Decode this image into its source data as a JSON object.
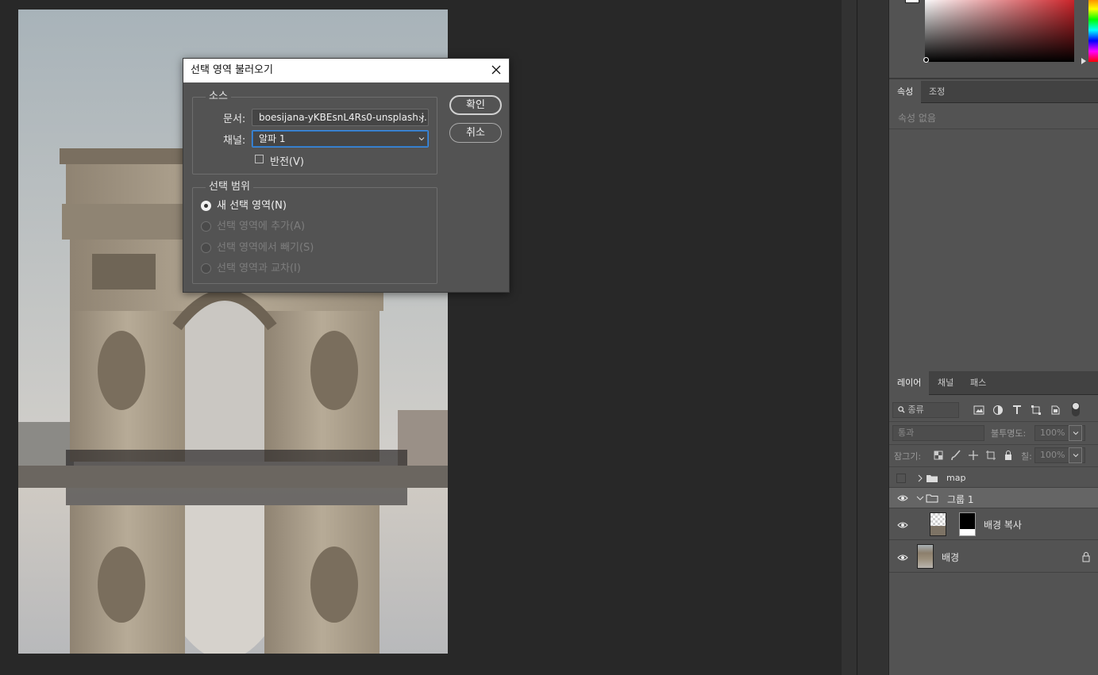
{
  "dialog": {
    "title": "선택 영역 불러오기",
    "source_group": "소스",
    "document_label": "문서:",
    "document_value": "boesijana-yKBEsnL4Rs0-unsplash.j...",
    "channel_label": "채널:",
    "channel_value": "알파 1",
    "invert_label": "반전(V)",
    "operation_group": "선택 범위",
    "options": [
      {
        "label": "새 선택 영역(N)",
        "selected": true,
        "enabled": true
      },
      {
        "label": "선택 영역에 추가(A)",
        "selected": false,
        "enabled": false
      },
      {
        "label": "선택 영역에서 빼기(S)",
        "selected": false,
        "enabled": false
      },
      {
        "label": "선택 영역과 교차(I)",
        "selected": false,
        "enabled": false
      }
    ],
    "ok_label": "확인",
    "cancel_label": "취소"
  },
  "properties_panel": {
    "tabs": [
      "속성",
      "조정"
    ],
    "empty_text": "속성 없음"
  },
  "layers_panel": {
    "tabs": [
      "레이어",
      "채널",
      "패스"
    ],
    "filter_kind": "종류",
    "blend_mode": "통과",
    "opacity_label": "불투명도:",
    "opacity_value": "100%",
    "lock_label": "잠그기:",
    "fill_label": "칠:",
    "fill_value": "100%",
    "layers": [
      {
        "name": "map",
        "type": "group",
        "expanded": false,
        "visible": false
      },
      {
        "name": "그룹 1",
        "type": "group",
        "expanded": true,
        "visible": true
      },
      {
        "name": "배경 복사",
        "type": "layer-with-mask",
        "visible": true
      },
      {
        "name": "배경",
        "type": "background",
        "visible": true,
        "locked": true
      }
    ]
  },
  "colors": {
    "app_bg": "#282828",
    "panel_bg": "#535353",
    "focus_blue": "#3d8ee6"
  }
}
